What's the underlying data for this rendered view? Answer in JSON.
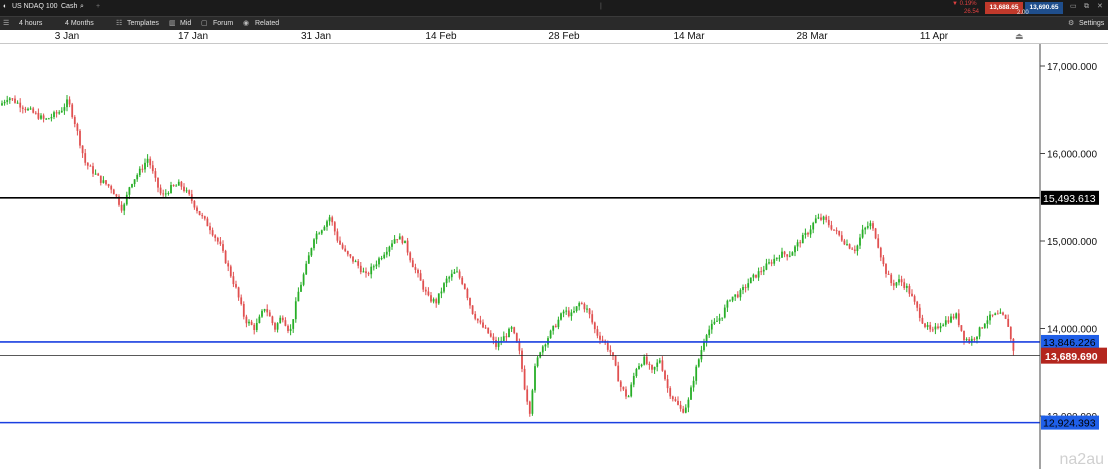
{
  "header": {
    "instrument": "US NDAQ 100",
    "type": "Cash",
    "change_pct": "▼ 0.19%",
    "change_pts": "26.54",
    "sell": "13,688.65",
    "buy": "13,690.65",
    "spread": "2.00"
  },
  "toolbar": {
    "timeframe": "4 hours",
    "range": "4 Months",
    "templates": "Templates",
    "mid": "Mid",
    "forum": "Forum",
    "related": "Related",
    "settings": "Settings"
  },
  "dates": [
    "3 Jan",
    "17 Jan",
    "31 Jan",
    "14 Feb",
    "28 Feb",
    "14 Mar",
    "28 Mar",
    "11 Apr"
  ],
  "watermark": "na2au",
  "colors": {
    "up": "#27ae27",
    "down": "#e05050",
    "price_badge": "#b3261e",
    "support": "#1a3fe0",
    "resistance": "#000000"
  },
  "chart_data": {
    "type": "candlestick",
    "y_axis_ticks": [
      "17,000.000",
      "16,000.000",
      "15,000.000",
      "14,000.000",
      "13,000.000"
    ],
    "ylim": [
      12800,
      17130
    ],
    "horizontal_lines": [
      {
        "label": "15,493.613",
        "value": 15493.613,
        "color": "#000000"
      },
      {
        "label": "13,846.226",
        "value": 13846.226,
        "color": "#1a3fe0"
      },
      {
        "label": "12,924.393",
        "value": 12924.393,
        "color": "#1a3fe0"
      }
    ],
    "current_price": {
      "label": "13,689.690",
      "value": 13689.69
    },
    "price_path": [
      [
        0,
        16550
      ],
      [
        8,
        16650
      ],
      [
        25,
        16520
      ],
      [
        45,
        16380
      ],
      [
        60,
        16480
      ],
      [
        68,
        16600
      ],
      [
        75,
        16350
      ],
      [
        85,
        15900
      ],
      [
        100,
        15700
      ],
      [
        112,
        15600
      ],
      [
        123,
        15350
      ],
      [
        130,
        15650
      ],
      [
        140,
        15800
      ],
      [
        148,
        15950
      ],
      [
        155,
        15700
      ],
      [
        162,
        15500
      ],
      [
        170,
        15600
      ],
      [
        180,
        15650
      ],
      [
        190,
        15500
      ],
      [
        200,
        15300
      ],
      [
        210,
        15150
      ],
      [
        220,
        14950
      ],
      [
        228,
        14700
      ],
      [
        236,
        14450
      ],
      [
        245,
        14100
      ],
      [
        255,
        14000
      ],
      [
        265,
        14250
      ],
      [
        275,
        14000
      ],
      [
        282,
        14150
      ],
      [
        290,
        13950
      ],
      [
        298,
        14400
      ],
      [
        306,
        14700
      ],
      [
        314,
        15050
      ],
      [
        322,
        15150
      ],
      [
        330,
        15280
      ],
      [
        338,
        15000
      ],
      [
        346,
        14850
      ],
      [
        356,
        14750
      ],
      [
        366,
        14600
      ],
      [
        376,
        14750
      ],
      [
        386,
        14900
      ],
      [
        396,
        15050
      ],
      [
        404,
        15000
      ],
      [
        412,
        14750
      ],
      [
        420,
        14550
      ],
      [
        428,
        14350
      ],
      [
        436,
        14300
      ],
      [
        446,
        14550
      ],
      [
        456,
        14650
      ],
      [
        464,
        14500
      ],
      [
        472,
        14200
      ],
      [
        480,
        14050
      ],
      [
        488,
        13950
      ],
      [
        496,
        13800
      ],
      [
        504,
        13900
      ],
      [
        512,
        14000
      ],
      [
        520,
        13700
      ],
      [
        525,
        13300
      ],
      [
        530,
        13050
      ],
      [
        534,
        13500
      ],
      [
        540,
        13750
      ],
      [
        548,
        13900
      ],
      [
        556,
        14050
      ],
      [
        564,
        14200
      ],
      [
        572,
        14150
      ],
      [
        580,
        14300
      ],
      [
        588,
        14200
      ],
      [
        596,
        13950
      ],
      [
        604,
        13850
      ],
      [
        612,
        13700
      ],
      [
        620,
        13350
      ],
      [
        628,
        13200
      ],
      [
        636,
        13550
      ],
      [
        644,
        13650
      ],
      [
        652,
        13500
      ],
      [
        660,
        13650
      ],
      [
        668,
        13300
      ],
      [
        676,
        13150
      ],
      [
        682,
        13050
      ],
      [
        688,
        13150
      ],
      [
        694,
        13450
      ],
      [
        700,
        13700
      ],
      [
        706,
        13950
      ],
      [
        714,
        14050
      ],
      [
        722,
        14150
      ],
      [
        730,
        14350
      ],
      [
        740,
        14400
      ],
      [
        750,
        14550
      ],
      [
        760,
        14650
      ],
      [
        770,
        14750
      ],
      [
        780,
        14850
      ],
      [
        790,
        14850
      ],
      [
        800,
        15000
      ],
      [
        808,
        15100
      ],
      [
        816,
        15250
      ],
      [
        824,
        15250
      ],
      [
        832,
        15150
      ],
      [
        840,
        15050
      ],
      [
        848,
        14950
      ],
      [
        856,
        14900
      ],
      [
        862,
        15100
      ],
      [
        870,
        15200
      ],
      [
        876,
        15050
      ],
      [
        884,
        14700
      ],
      [
        892,
        14500
      ],
      [
        900,
        14550
      ],
      [
        908,
        14450
      ],
      [
        916,
        14250
      ],
      [
        924,
        14050
      ],
      [
        932,
        13950
      ],
      [
        940,
        14050
      ],
      [
        948,
        14100
      ],
      [
        956,
        14150
      ],
      [
        964,
        13900
      ],
      [
        970,
        13850
      ],
      [
        978,
        13950
      ],
      [
        986,
        14100
      ],
      [
        994,
        14150
      ],
      [
        1002,
        14150
      ],
      [
        1008,
        14050
      ],
      [
        1012,
        13800
      ],
      [
        1016,
        13690
      ]
    ]
  }
}
